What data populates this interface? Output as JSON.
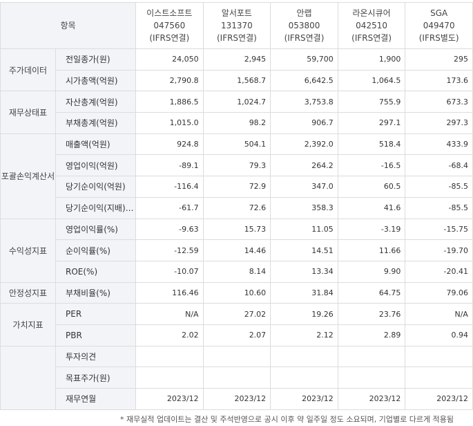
{
  "header": {
    "corner": "항목",
    "companies": [
      {
        "name": "이스트소프트",
        "code": "047560",
        "basis": "(IFRS연결)"
      },
      {
        "name": "알서포트",
        "code": "131370",
        "basis": "(IFRS연결)"
      },
      {
        "name": "안랩",
        "code": "053800",
        "basis": "(IFRS연결)"
      },
      {
        "name": "라온시큐어",
        "code": "042510",
        "basis": "(IFRS연결)"
      },
      {
        "name": "SGA",
        "code": "049470",
        "basis": "(IFRS별도)"
      }
    ]
  },
  "groups": [
    {
      "category": "주가데이터",
      "rows": [
        {
          "label": "전일종가(원)",
          "values": [
            "24,050",
            "2,945",
            "59,700",
            "1,900",
            "295"
          ]
        },
        {
          "label": "시가총액(억원)",
          "values": [
            "2,790.8",
            "1,568.7",
            "6,642.5",
            "1,064.5",
            "173.6"
          ]
        }
      ]
    },
    {
      "category": "재무상태표",
      "rows": [
        {
          "label": "자산총계(억원)",
          "values": [
            "1,886.5",
            "1,024.7",
            "3,753.8",
            "755.9",
            "673.3"
          ]
        },
        {
          "label": "부채총계(억원)",
          "values": [
            "1,015.0",
            "98.2",
            "906.7",
            "297.1",
            "297.3"
          ]
        }
      ]
    },
    {
      "category": "포괄손익계산서",
      "rows": [
        {
          "label": "매출액(억원)",
          "values": [
            "924.8",
            "504.1",
            "2,392.0",
            "518.4",
            "433.9"
          ]
        },
        {
          "label": "영업이익(억원)",
          "values": [
            "-89.1",
            "79.3",
            "264.2",
            "-16.5",
            "-68.4"
          ]
        },
        {
          "label": "당기순이익(억원)",
          "values": [
            "-116.4",
            "72.9",
            "347.0",
            "60.5",
            "-85.5"
          ]
        },
        {
          "label": "당기순이익(지배)…",
          "values": [
            "-61.7",
            "72.6",
            "358.3",
            "41.6",
            "-85.5"
          ]
        }
      ]
    },
    {
      "category": "수익성지표",
      "rows": [
        {
          "label": "영업이익률(%)",
          "values": [
            "-9.63",
            "15.73",
            "11.05",
            "-3.19",
            "-15.75"
          ]
        },
        {
          "label": "순이익률(%)",
          "values": [
            "-12.59",
            "14.46",
            "14.51",
            "11.66",
            "-19.70"
          ]
        },
        {
          "label": "ROE(%)",
          "values": [
            "-10.07",
            "8.14",
            "13.34",
            "9.90",
            "-20.41"
          ]
        }
      ]
    },
    {
      "category": "안정성지표",
      "rows": [
        {
          "label": "부채비율(%)",
          "values": [
            "116.46",
            "10.60",
            "31.84",
            "64.75",
            "79.06"
          ]
        }
      ]
    },
    {
      "category": "가치지표",
      "rows": [
        {
          "label": "PER",
          "values": [
            "N/A",
            "27.02",
            "19.26",
            "23.76",
            "N/A"
          ]
        },
        {
          "label": "PBR",
          "values": [
            "2.02",
            "2.07",
            "2.12",
            "2.89",
            "0.94"
          ]
        }
      ]
    },
    {
      "category": "",
      "rows": [
        {
          "label": "투자의견",
          "values": [
            "",
            "",
            "",
            "",
            ""
          ]
        },
        {
          "label": "목표주가(원)",
          "values": [
            "",
            "",
            "",
            "",
            ""
          ]
        },
        {
          "label": "재무연월",
          "values": [
            "2023/12",
            "2023/12",
            "2023/12",
            "2023/12",
            "2023/12"
          ]
        }
      ]
    }
  ],
  "footnote": "* 재무실적 업데이트는 결산 및 주석반영으로 공시 이후 약 일주일 정도 소요되며, 기업별로 다르게 적용됨"
}
